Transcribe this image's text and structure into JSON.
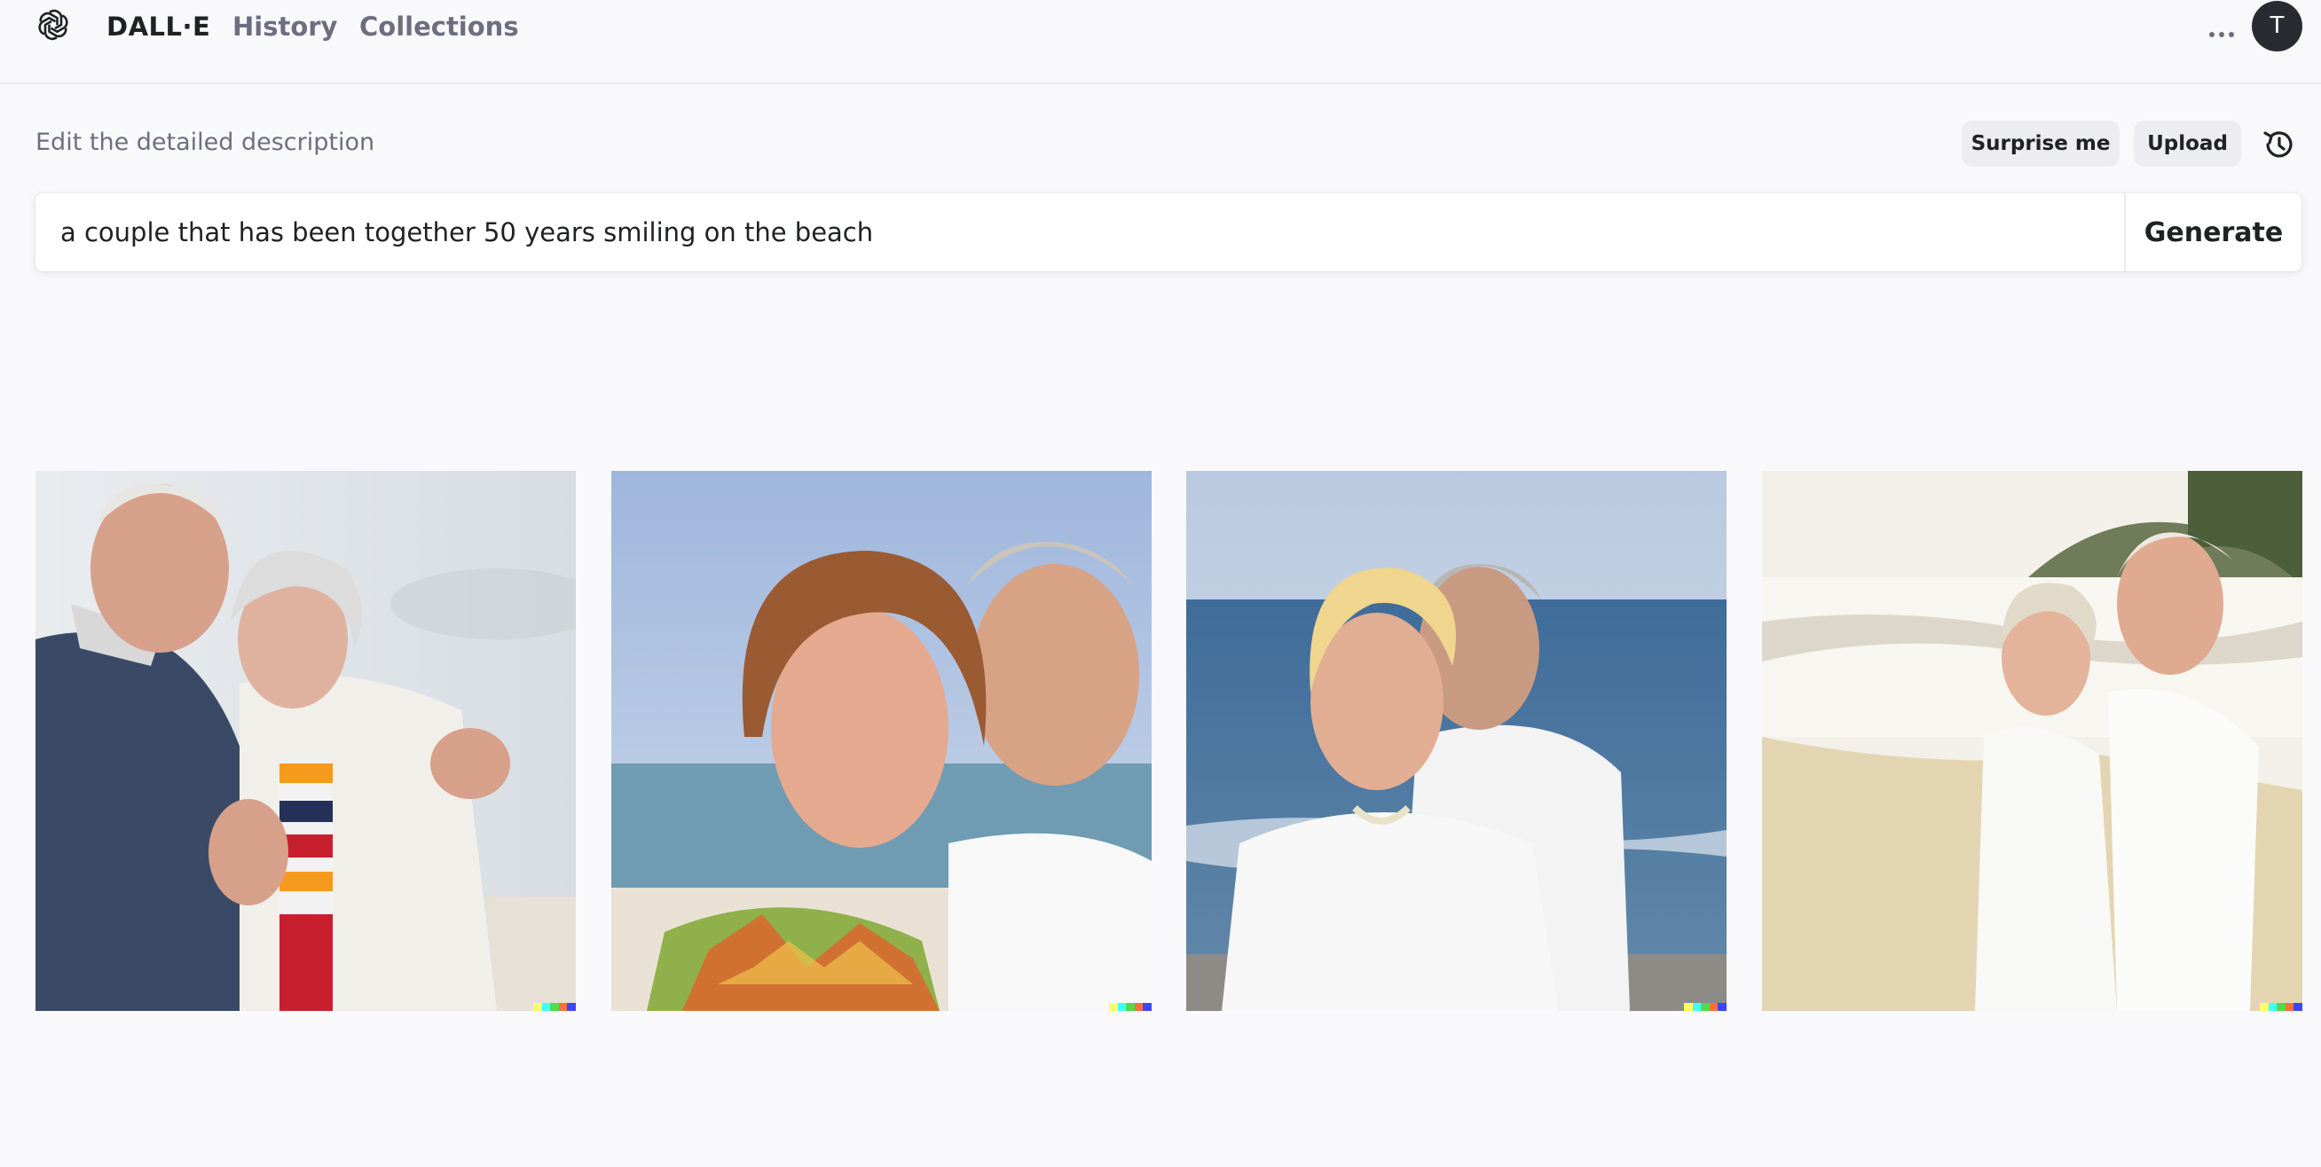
{
  "app": {
    "brand": "DALL·E",
    "nav": {
      "history": "History",
      "collections": "Collections"
    },
    "more_icon": "ellipsis-icon",
    "avatar_initial": "T"
  },
  "prompt_area": {
    "hint": "Edit the detailed description",
    "surprise_label": "Surprise me",
    "upload_label": "Upload",
    "history_icon": "history-clock-icon",
    "prompt_value": "a couple that has been together 50 years smiling on the beach",
    "generate_label": "Generate"
  },
  "results": {
    "count": 4,
    "signature_colors": [
      "#ffff66",
      "#42ffff",
      "#51da4c",
      "#ff6e3c",
      "#3c46ff"
    ]
  },
  "colors": {
    "background": "#f9f9fb",
    "text": "#202123",
    "muted_text": "#6e6e80",
    "pill_background": "#ececf1"
  }
}
